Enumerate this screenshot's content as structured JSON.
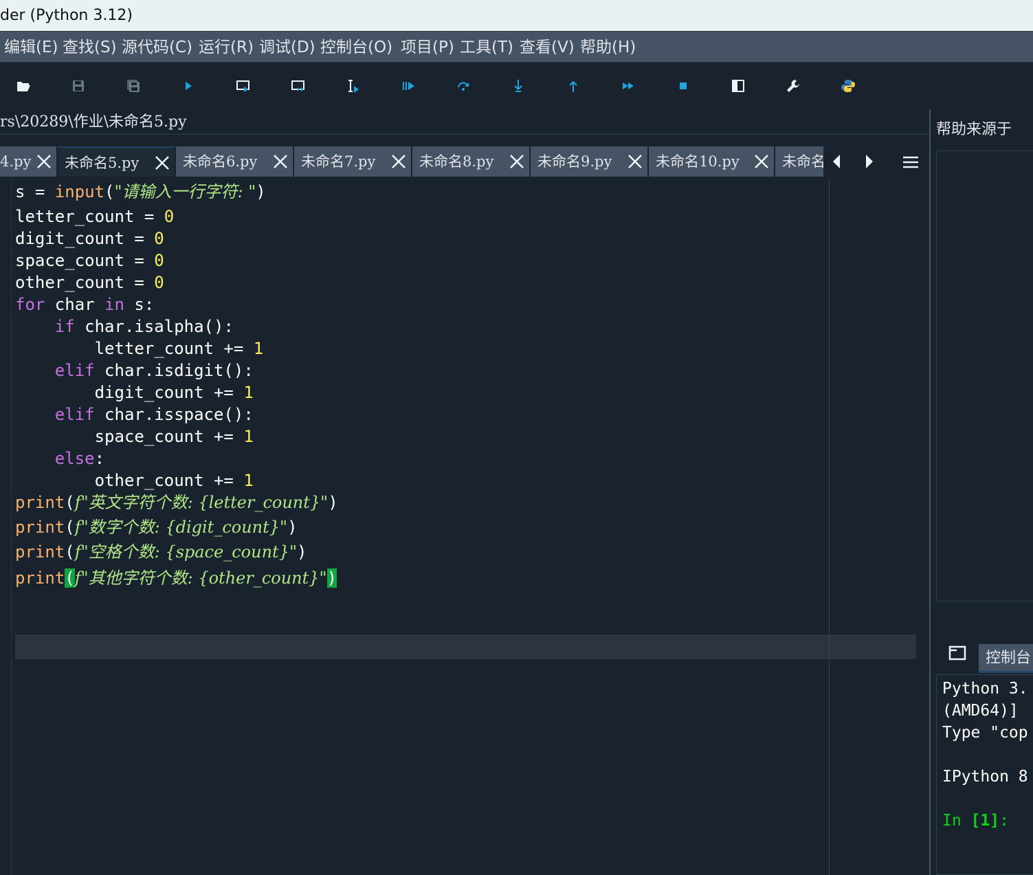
{
  "window": {
    "title": "der (Python 3.12)"
  },
  "menubar": {
    "items": [
      "编辑(E)",
      "查找(S)",
      "源代码(C)",
      "运行(R)",
      "调试(D)",
      "控制台(O)",
      "项目(P)",
      "工具(T)",
      "查看(V)",
      "帮助(H)"
    ]
  },
  "toolbar": {
    "icons": [
      "open-folder-icon",
      "save-icon",
      "save-all-icon",
      "run-icon",
      "run-cell-icon",
      "run-cell-advance-icon",
      "run-selection-icon",
      "debug-icon",
      "step-over-icon",
      "step-into-icon",
      "step-return-icon",
      "continue-icon",
      "stop-icon",
      "maximize-pane-icon",
      "preferences-wrench-icon",
      "python-path-icon"
    ],
    "accent": "#1e8fe0"
  },
  "editor": {
    "path": "rs\\20289\\作业\\未命名5.py",
    "tabs": [
      {
        "label": "4.py",
        "active": false
      },
      {
        "label": "未命名5.py",
        "active": true
      },
      {
        "label": "未命名6.py",
        "active": false
      },
      {
        "label": "未命名7.py",
        "active": false
      },
      {
        "label": "未命名8.py",
        "active": false
      },
      {
        "label": "未命名9.py",
        "active": false
      },
      {
        "label": "未命名10.py",
        "active": false
      },
      {
        "label": "未命名",
        "active": false
      }
    ],
    "code_lines": [
      "s = input(\"请输入一行字符: \")",
      "letter_count = 0",
      "digit_count = 0",
      "space_count = 0",
      "other_count = 0",
      "for char in s:",
      "    if char.isalpha():",
      "        letter_count += 1",
      "    elif char.isdigit():",
      "        digit_count += 1",
      "    elif char.isspace():",
      "        space_count += 1",
      "    else:",
      "        other_count += 1",
      "print(f\"英文字符个数: {letter_count}\")",
      "print(f\"数字个数: {digit_count}\")",
      "print(f\"空格个数: {space_count}\")",
      "print(f\"其他字符个数: {other_count}\")"
    ]
  },
  "help_pane": {
    "title": "帮助来源于"
  },
  "console": {
    "tab_label": "控制台",
    "lines": [
      "Python 3.",
      "(AMD64)]",
      "Type \"cop",
      "",
      "IPython 8"
    ],
    "prompt_in": "In ",
    "prompt_num": "[1]",
    "prompt_colon": ":"
  }
}
